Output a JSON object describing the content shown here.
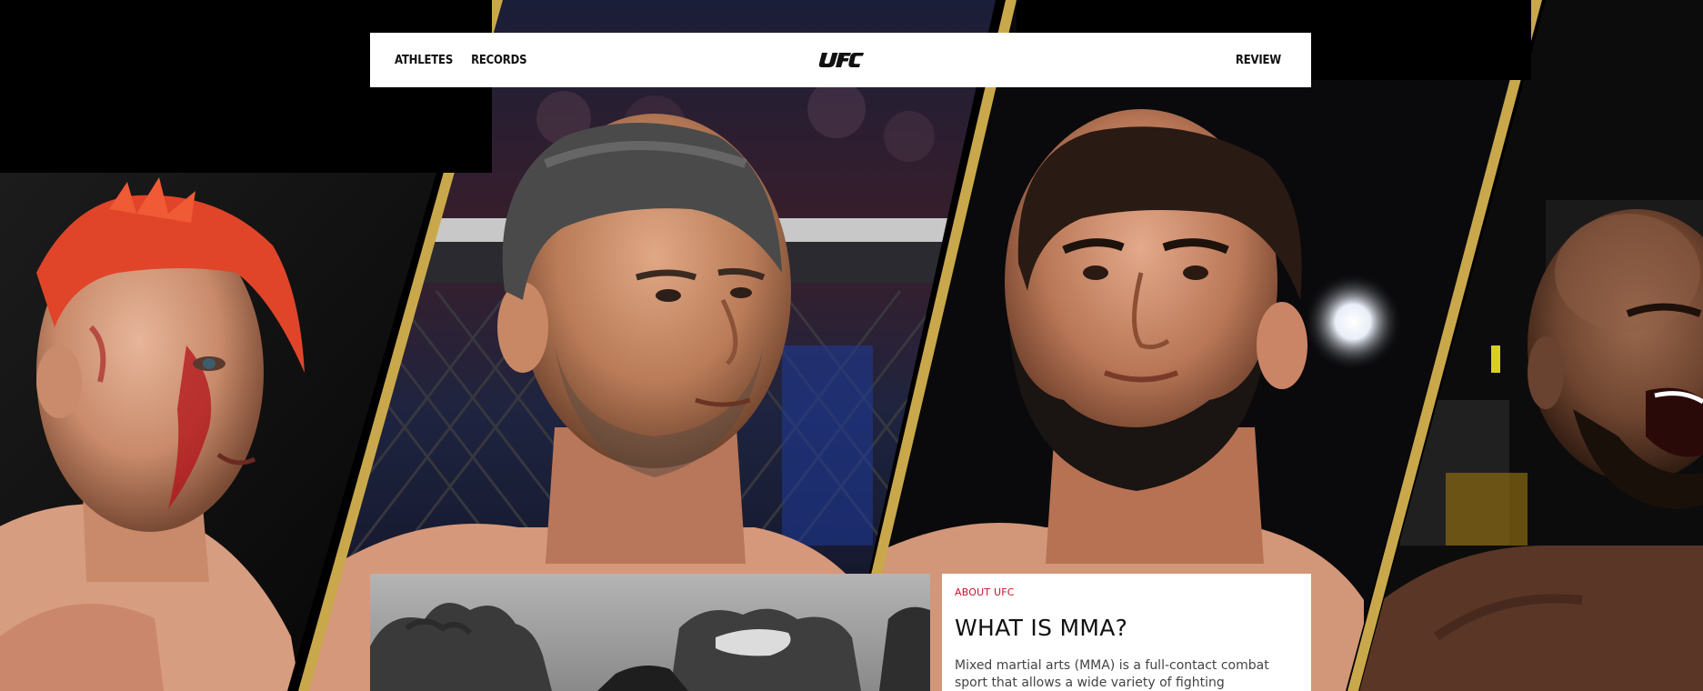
{
  "nav": {
    "left_links": [
      "ATHLETES",
      "RECORDS"
    ],
    "right_link": "REVIEW",
    "logo_text": "UFC",
    "logo_icon": "ufc-logo"
  },
  "about": {
    "eyebrow": "ABOUT UFC",
    "title": "WHAT IS MMA?",
    "body": "Mixed martial arts (MMA) is a full-contact combat sport that allows a wide variety of fighting techniques"
  },
  "colors": {
    "accent_gold": "#c9a84c",
    "eyebrow_red": "#c8102e",
    "background": "#000000",
    "card": "#ffffff"
  },
  "hero": {
    "fighters": [
      "fighter-red-hair",
      "fighter-gray-hair",
      "fighter-bearded",
      "fighter-shouting"
    ]
  }
}
